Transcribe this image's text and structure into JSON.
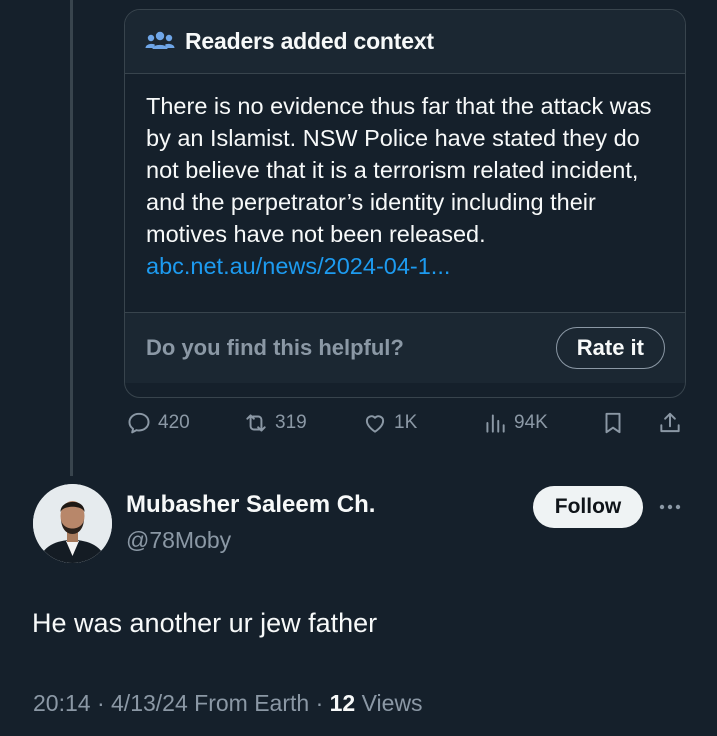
{
  "context_card": {
    "title": "Readers added context",
    "body": "There is no evidence thus far that the attack was by an Islamist. NSW Police have stated they do not believe that it is a terrorism related incident, and the perpetrator’s identity including their motives have not been released.",
    "link": "abc.net.au/news/2024-04-1...",
    "question": "Do you find this helpful?",
    "rate_label": "Rate it",
    "header_icon": "people-icon"
  },
  "actions": {
    "replies": "420",
    "reposts": "319",
    "likes": "1K",
    "views": "94K"
  },
  "reply": {
    "author_name": "Mubasher Saleem Ch.",
    "author_handle": "@78Moby",
    "follow_label": "Follow",
    "text": "He was another ur jew father",
    "time": "20:14",
    "date": "4/13/24",
    "source": "From Earth",
    "views_count": "12",
    "views_label": "Views"
  },
  "colors": {
    "background": "#15202b",
    "link": "#1d9bf0",
    "muted": "#8b98a5",
    "border": "#38444d"
  }
}
